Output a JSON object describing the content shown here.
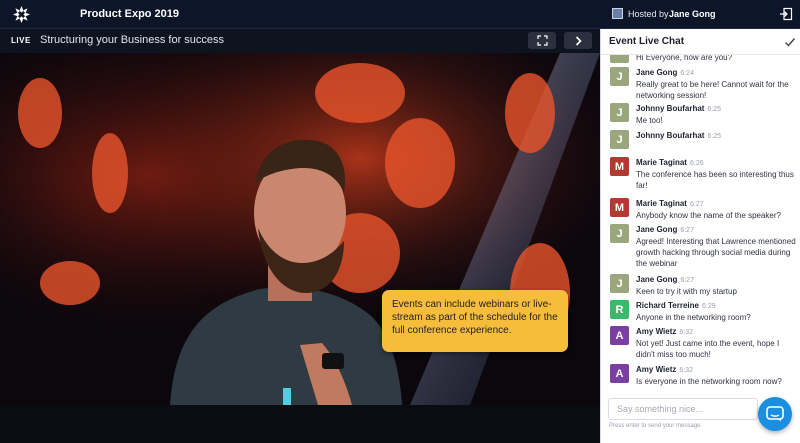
{
  "topbar": {
    "app_title": "Product Expo 2019",
    "host_prefix": "Hosted by",
    "host_name": "Jane Gong"
  },
  "video": {
    "live_label": "LIVE",
    "session_title": "Structuring your Business for success"
  },
  "callout": {
    "text": "Events can include webinars or live-stream as part of the schedule for the full conference experience."
  },
  "chat": {
    "title": "Event Live Chat",
    "messages": [
      {
        "initial": "",
        "name": "",
        "time": "",
        "text": "Hi Everyone, how are you?",
        "color": "#9aa67b"
      },
      {
        "initial": "J",
        "name": "Jane Gong",
        "time": "6:24",
        "text": "Really great to be here! Cannot wait for the networking session!",
        "color": "#9aa67b"
      },
      {
        "initial": "J",
        "name": "Johnny Boufarhat",
        "time": "6:25",
        "text": "Me too!",
        "color": "#9aa67b"
      },
      {
        "initial": "J",
        "name": "Johnny Boufarhat",
        "time": "6:25",
        "text": "",
        "color": "#9aa67b"
      },
      {
        "initial": "M",
        "name": "Marie Taginat",
        "time": "6:26",
        "text": "The conference has been so interesting thus far!",
        "color": "#b23a33"
      },
      {
        "initial": "M",
        "name": "Marie Taginat",
        "time": "6:27",
        "text": "Anybody know the name of the speaker?",
        "color": "#b23a33"
      },
      {
        "initial": "J",
        "name": "Jane Gong",
        "time": "6:27",
        "text": "Agreed! Interesting that Lawrence mentioned growth hacking through social media during the webinar",
        "color": "#9aa67b"
      },
      {
        "initial": "J",
        "name": "Jane Gong",
        "time": "6:27",
        "text": "Keen to try it with my startup",
        "color": "#9aa67b"
      },
      {
        "initial": "R",
        "name": "Richard Terreine",
        "time": "6:29",
        "text": "Anyone in the networking room?",
        "color": "#3cb86b"
      },
      {
        "initial": "A",
        "name": "Amy Wietz",
        "time": "6:32",
        "text": "Not yet! Just came into the event, hope I didn't miss too much!",
        "color": "#7b3fa3"
      },
      {
        "initial": "A",
        "name": "Amy Wietz",
        "time": "6:32",
        "text": "Is everyone in the networking room now?",
        "color": "#7b3fa3"
      }
    ],
    "input_placeholder": "Say something nice...",
    "hint": "Press enter to send your message."
  },
  "icons": {
    "logo": "event-logo-icon",
    "exit": "exit-icon",
    "fullscreen": "fullscreen-icon",
    "next": "chevron-right-icon",
    "check": "check-icon",
    "support": "chat-support-icon"
  }
}
